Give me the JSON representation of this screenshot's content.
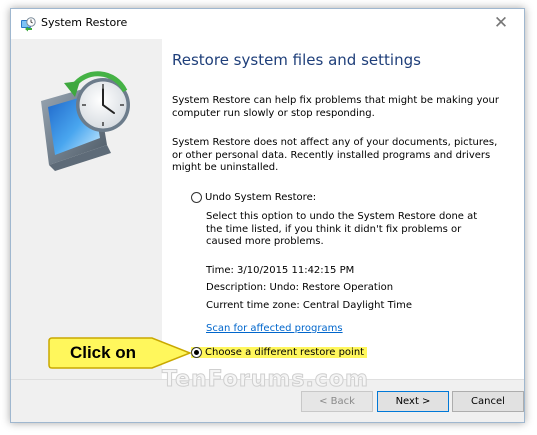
{
  "window": {
    "title": "System Restore",
    "close_glyph": "✕"
  },
  "icons": [
    "system-restore-app-icon",
    "system-restore-clock-icon",
    "close-icon"
  ],
  "main": {
    "heading": "Restore system files and settings",
    "intro": "System Restore can help fix problems that might be making your computer run slowly or stop responding.",
    "note": "System Restore does not affect any of your documents, pictures, or other personal data. Recently installed programs and drivers might be uninstalled.",
    "undo_option": {
      "label": "Undo System Restore:",
      "selected": false,
      "description": "Select this option to undo the System Restore done at the time listed, if you think it didn't fix problems or caused more problems.",
      "time": "Time: 3/10/2015 11:42:15 PM",
      "desc_line": "Description: Undo: Restore Operation",
      "timezone": "Current time zone: Central Daylight Time",
      "scan_link": "Scan for affected programs"
    },
    "choose_option": {
      "label": "Choose a different restore point",
      "selected": true
    }
  },
  "footer": {
    "back_label": "< Back",
    "next_label": "Next >",
    "cancel_label": "Cancel",
    "watermark": "TenForums.com"
  },
  "annotation": {
    "callout_text": "Click on",
    "color": "#fff75c"
  },
  "colors": {
    "heading": "#1f3f7a",
    "link": "#0066cc",
    "sidebar": "#f0f0f0",
    "highlight": "#fff75c"
  }
}
